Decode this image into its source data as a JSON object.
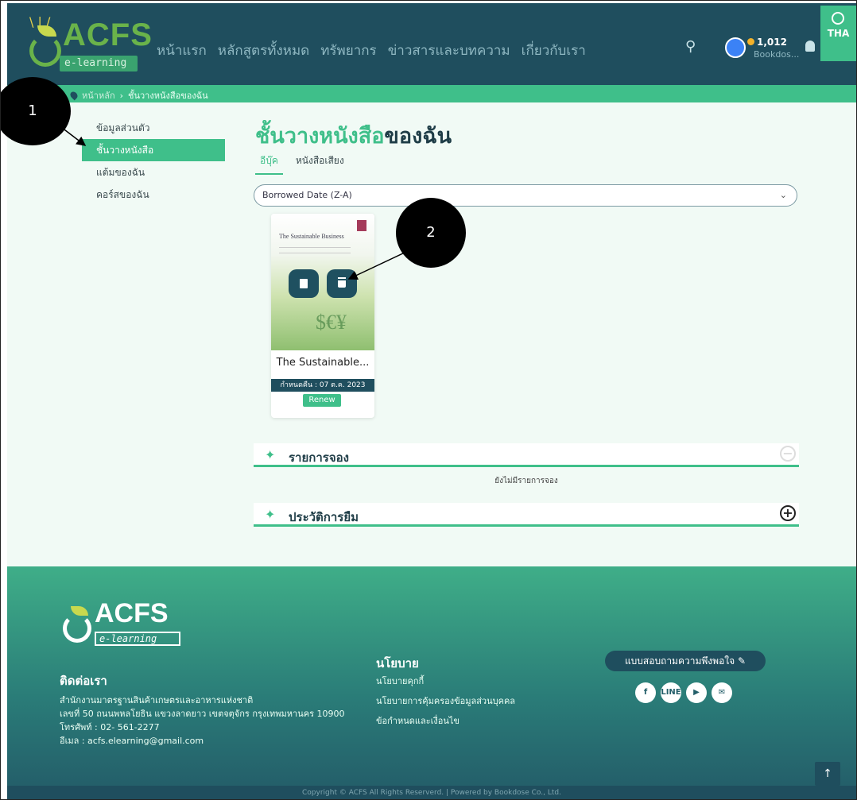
{
  "header": {
    "logo_text": "ACFS",
    "logo_sub": "e-learning",
    "nav": [
      "หน้าแรก",
      "หลักสูตรทั้งหมด",
      "ทรัพยากร",
      "ข่าวสารและบทความ",
      "เกี่ยวกับเรา"
    ],
    "coins": "1,012",
    "username": "Bookdos...",
    "lang": "THA"
  },
  "breadcrumb": {
    "home": "หน้าหลัก",
    "current": "ชั้นวางหนังสือของฉัน"
  },
  "sidebar": {
    "items": [
      {
        "label": "ข้อมูลส่วนตัว"
      },
      {
        "label": "ชั้นวางหนังสือ"
      },
      {
        "label": "แต้มของฉัน"
      },
      {
        "label": "คอร์สของฉัน"
      }
    ]
  },
  "main": {
    "title_a": "ชั้นวางหนังสือ",
    "title_b": "ของฉัน",
    "tabs": [
      "อีบุ๊ค",
      "หนังสือเสียง"
    ],
    "sort_value": "Borrowed Date (Z-A)",
    "book": {
      "cover_title": "The Sustainable Business",
      "title": "The Sustainable...",
      "due": "กำหนดคืน : 07 ต.ค. 2023",
      "renew": "Renew"
    },
    "reservation_label": "รายการจอง",
    "reservation_empty": "ยังไม่มีรายการจอง",
    "history_label": "ประวัติการยืม"
  },
  "footer": {
    "logo_text": "ACFS",
    "logo_sub": "e-learning",
    "contact_heading": "ติดต่อเรา",
    "contact_lines": [
      "สำนักงานมาตรฐานสินค้าเกษตรและอาหารแห่งชาติ",
      "เลขที่ 50 ถนนพหลโยธิน แขวงลาดยาว เขตจตุจักร กรุงเทพมหานคร 10900",
      "โทรศัพท์ : 02- 561-2277",
      "อีเมล : acfs.elearning@gmail.com"
    ],
    "policy_heading": "นโยบาย",
    "policy_links": [
      "นโยบายคุกกี้",
      "นโยบายการคุ้มครองข้อมูลส่วนบุคคล",
      "ข้อกำหนดและเงื่อนไข"
    ],
    "survey": "แบบสอบถามความพึงพอใจ",
    "socials": [
      "f",
      "LINE",
      "▶",
      "✉"
    ],
    "copyright": "Copyright © ACFS All Rights Reserverd. | Powered by Bookdose Co., Ltd."
  },
  "annotations": {
    "c1": "1",
    "c2": "2"
  }
}
